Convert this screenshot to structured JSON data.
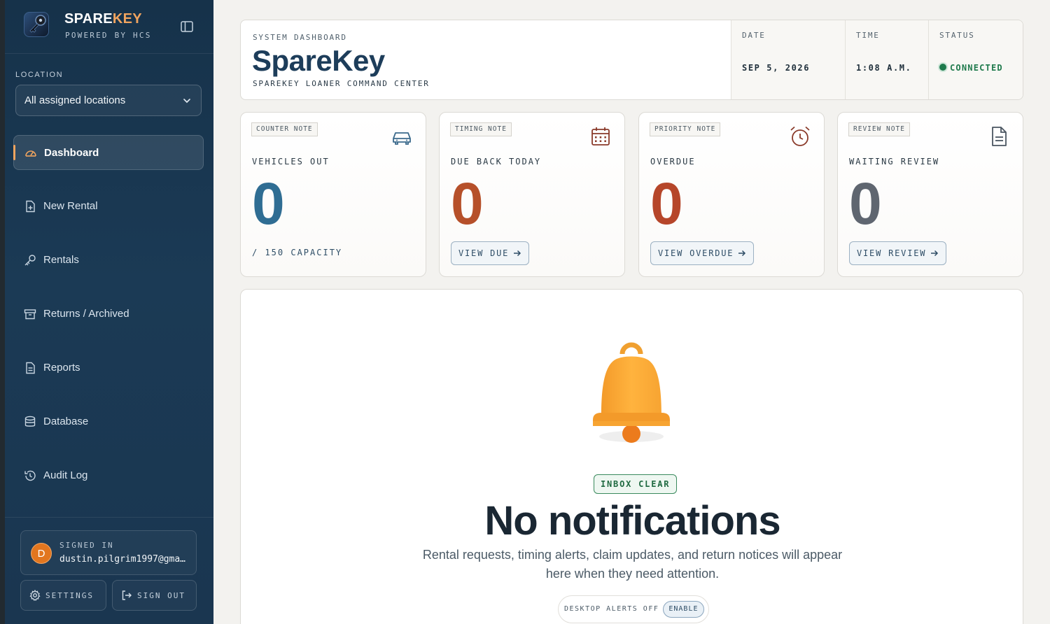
{
  "brand": {
    "name_part1": "SPARE",
    "name_part2": "KEY",
    "tagline": "POWERED BY HCS"
  },
  "sidebar": {
    "location_label": "LOCATION",
    "location_value": "All assigned locations",
    "items": [
      {
        "label": "Dashboard",
        "icon": "gauge-icon",
        "active": true
      },
      {
        "label": "New Rental",
        "icon": "file-plus-icon"
      },
      {
        "label": "Rentals",
        "icon": "key-icon"
      },
      {
        "label": "Returns / Archived",
        "icon": "archive-icon"
      },
      {
        "label": "Reports",
        "icon": "file-text-icon"
      },
      {
        "label": "Database",
        "icon": "database-icon"
      },
      {
        "label": "Audit Log",
        "icon": "history-icon"
      }
    ],
    "user": {
      "signed_in_label": "SIGNED IN",
      "email": "dustin.pilgrim1997@gma…",
      "avatar_initial": "D"
    },
    "settings_label": "SETTINGS",
    "signout_label": "SIGN OUT"
  },
  "header": {
    "eyebrow": "SYSTEM DASHBOARD",
    "title": "SpareKey",
    "subtitle": "SPAREKEY LOANER COMMAND CENTER",
    "date_label": "DATE",
    "date_value": "SEP 5, 2026",
    "time_label": "TIME",
    "time_value": "1:08 A.M.",
    "status_label": "STATUS",
    "status_value": "CONNECTED"
  },
  "cards": [
    {
      "tag": "COUNTER NOTE",
      "label": "VEHICLES OUT",
      "value": "0",
      "caption": "/ 150 CAPACITY",
      "color": "#2f6d93",
      "icon": "car-icon"
    },
    {
      "tag": "TIMING NOTE",
      "label": "DUE BACK TODAY",
      "value": "0",
      "button": "VIEW DUE",
      "color": "#b6502a",
      "icon": "calendar-icon"
    },
    {
      "tag": "PRIORITY NOTE",
      "label": "OVERDUE",
      "value": "0",
      "button": "VIEW OVERDUE",
      "color": "#b6462a",
      "icon": "alarm-clock-icon"
    },
    {
      "tag": "REVIEW NOTE",
      "label": "WAITING REVIEW",
      "value": "0",
      "button": "VIEW REVIEW",
      "color": "#5f6670",
      "icon": "document-icon"
    }
  ],
  "notifications": {
    "badge": "INBOX CLEAR",
    "title": "No notifications",
    "description": "Rental requests, timing alerts, claim updates, and return notices will appear here when they need attention.",
    "alerts_status": "DESKTOP ALERTS OFF",
    "enable_label": "ENABLE"
  }
}
